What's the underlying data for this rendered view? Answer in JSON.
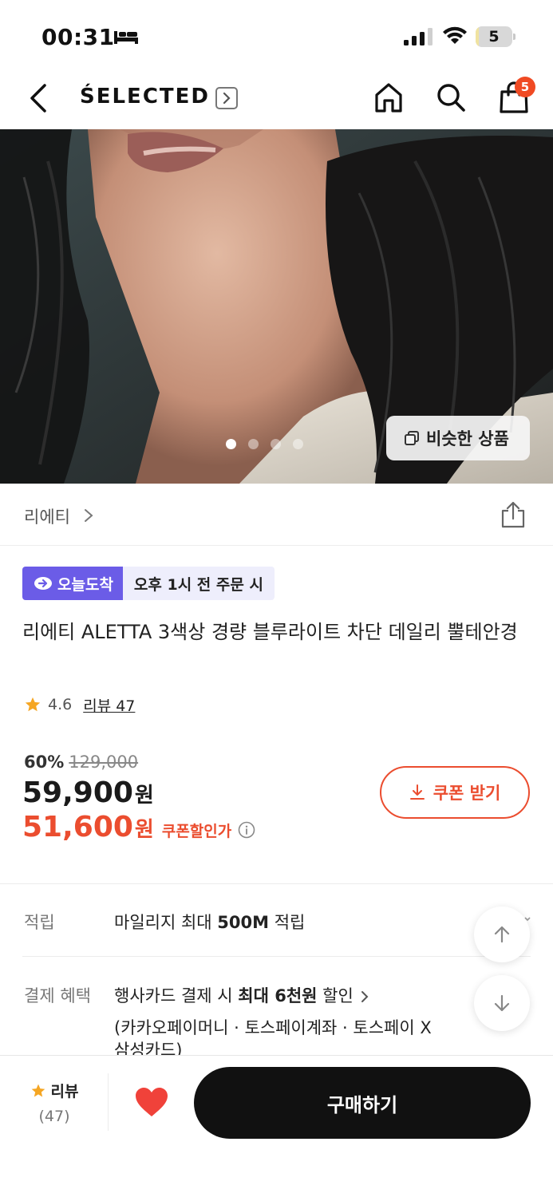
{
  "status_bar": {
    "time": "00:31",
    "battery": "5",
    "battery_level": 0.05
  },
  "header": {
    "brand": "ŚELECTED",
    "cart_count": "5"
  },
  "hero": {
    "slide_count": 4,
    "active_slide": 1,
    "similar_button": "비슷한 상품"
  },
  "brand_row": {
    "brand_name": "리에티"
  },
  "delivery": {
    "badge": "오늘도착",
    "time_text": "오후 1시 전 주문 시"
  },
  "product": {
    "title": "리에티 ALETTA 3색상 경량 블루라이트 차단 데일리 뿔테안경",
    "rating": "4.6",
    "reviews_link": "리뷰 47"
  },
  "price": {
    "discount_rate": "60%",
    "original": "129,000",
    "sale": "59,900",
    "unit": "원",
    "coupon_price": "51,600",
    "coupon_label": "쿠폰할인가",
    "coupon_button": "쿠폰 받기"
  },
  "info": {
    "points_label": "적립",
    "points_pre": "마일리지 최대 ",
    "points_bold": "500M",
    "points_post": " 적립",
    "benefit_label": "결제 혜택",
    "benefit_pre": "행사카드 결제 시 ",
    "benefit_bold": "최대 6천원",
    "benefit_post": " 할인",
    "benefit_detail_1": "(카카오페이머니 · 토스페이계좌 · 토스페이 X",
    "benefit_detail_2": "삼성카드)"
  },
  "bottom_bar": {
    "review_label": "리뷰",
    "review_count": "(47)",
    "buy_label": "구매하기"
  },
  "colors": {
    "accent": "#eb4d2f",
    "delivery_badge": "#6b5ce7",
    "heart": "#f0423a",
    "star": "#f5a623"
  }
}
